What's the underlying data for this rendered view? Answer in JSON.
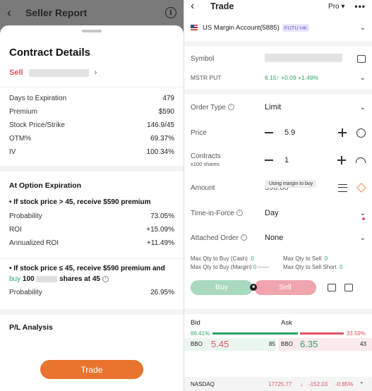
{
  "left": {
    "header_title": "Seller Report",
    "sheet_title": "Contract Details",
    "sell_label": "Sell",
    "details": [
      {
        "k": "Days to Expiration",
        "v": "479"
      },
      {
        "k": "Premium",
        "v": "$590"
      },
      {
        "k": "Stock Price/Strike",
        "v": "146.9/45"
      },
      {
        "k": "OTM%",
        "v": "69.37%"
      },
      {
        "k": "IV",
        "v": "100.34%"
      }
    ],
    "at_expiration_title": "At Option Expiration",
    "case1_title": "If stock price > 45, receive $590 premium",
    "case1_rows": [
      {
        "k": "Probability",
        "v": "73.05%"
      },
      {
        "k": "ROI",
        "v": "+15.09%"
      },
      {
        "k": "Annualized ROI",
        "v": "+11.49%"
      }
    ],
    "case2_line1": "If stock price ≤ 45, receive $590 premium and",
    "case2_buy": "buy",
    "case2_qty": "100",
    "case2_tail": "shares at 45",
    "case2_prob_label": "Probability",
    "case2_prob_value": "26.95%",
    "pl_title": "P/L Analysis",
    "trade_button": "Trade"
  },
  "right": {
    "title": "Trade",
    "pro_label": "Pro ▾",
    "more": "•••",
    "account": "US Margin Account(5885)",
    "broker_badge": "FUTU HK",
    "symbol_label": "Symbol",
    "underlying": "MSTR PUT",
    "price_quote": "6.15",
    "change": "+0.09",
    "change_pct": "+1.49%",
    "order_type_label": "Order Type",
    "order_type_value": "Limit",
    "price_label": "Price",
    "price_value": "5.9",
    "contracts_label": "Contracts",
    "contracts_sub": "x100 shares",
    "contracts_value": "1",
    "margin_tooltip": "Using margin to buy",
    "amount_label": "Amount",
    "amount_value": "590.00",
    "tif_label": "Time-in-Force",
    "tif_value": "Day",
    "attached_label": "Attached Order",
    "attached_value": "None",
    "max_buy_cash_label": "Max Qty to Buy (Cash)",
    "max_buy_cash_value": "0",
    "max_buy_margin_label": "Max Qty to Buy (Margin)",
    "max_buy_margin_value": "0",
    "max_sell_label": "Max Qty to Sell",
    "max_sell_value": "0",
    "max_short_label": "Max Qty to Sell Short",
    "max_short_value": "0",
    "buy_button": "Buy",
    "sell_button": "Sell",
    "bid_label": "Bid",
    "ask_label": "Ask",
    "bid_pct": "66.41%",
    "ask_pct": "33.59%",
    "bid_bar_fraction": 0.6641,
    "bid_exch": "BBO",
    "bid_price": "5.45",
    "bid_size": "85",
    "ask_exch": "BBO",
    "ask_price": "6.35",
    "ask_size": "43",
    "index_name": "NASDAQ",
    "index_value": "17725.77",
    "index_change": "-152.03",
    "index_change_pct": "-0.85%"
  },
  "colors": {
    "up": "#2ea26a",
    "down": "#e05365",
    "accent": "#e8742d",
    "futu_badge": "#6b57d6"
  }
}
